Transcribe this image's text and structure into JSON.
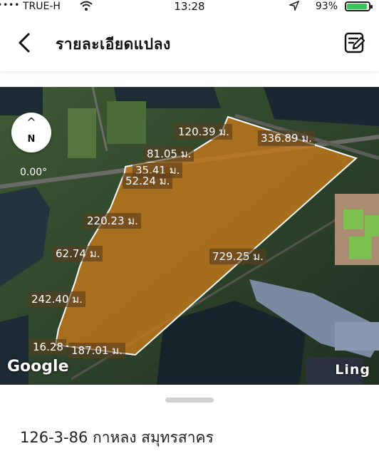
{
  "status_bar": {
    "carrier": "TRUE-H",
    "time": "13:28",
    "battery_percent": "93%",
    "battery_level": 0.93,
    "battery_color": "#3cc35a"
  },
  "header": {
    "title": "รายละเอียดแปลง",
    "back_icon": "chevron-left-icon",
    "edit_icon": "edit-note-icon"
  },
  "map": {
    "compass_arrow": "^",
    "compass_north": "N",
    "heading": "0.00°",
    "plot_fill_color": "#c97a1a",
    "measurements": [
      "120.39 ม.",
      "336.89 ม.",
      "81.05 ม.",
      "35.41 ม.",
      "52.24 ม.",
      "220.23 ม.",
      "62.74 ม.",
      "729.25 ม.",
      "242.40 ม.",
      "16.28",
      "187.01 ม."
    ],
    "attribution": "Google",
    "watermark": "Ling"
  },
  "sheet": {
    "plot_info": "126-3-86 กาหลง สมุทรสาคร"
  }
}
